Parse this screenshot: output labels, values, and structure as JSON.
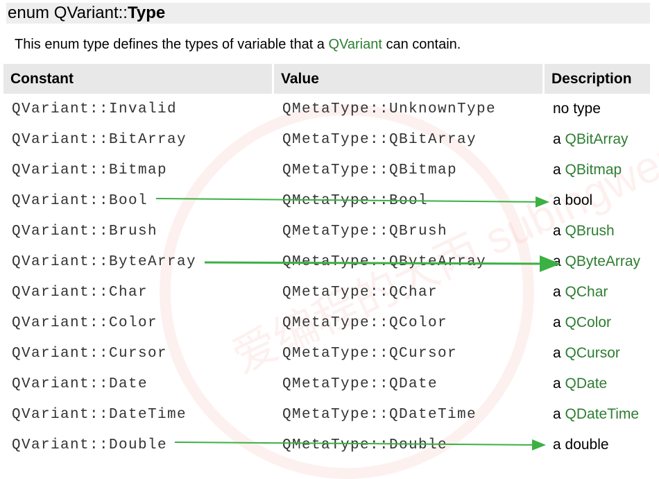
{
  "heading": {
    "prefix": "enum QVariant::",
    "name": "Type"
  },
  "intro": {
    "before": "This enum type defines the types of variable that a ",
    "link": "QVariant",
    "after": " can contain."
  },
  "table": {
    "headers": [
      "Constant",
      "Value",
      "Description"
    ],
    "rows": [
      {
        "constant": "QVariant::Invalid",
        "value": "QMetaType::UnknownType",
        "desc_prefix": "",
        "desc_text": "no type",
        "desc_link": ""
      },
      {
        "constant": "QVariant::BitArray",
        "value": "QMetaType::QBitArray",
        "desc_prefix": "a ",
        "desc_text": "",
        "desc_link": "QBitArray"
      },
      {
        "constant": "QVariant::Bitmap",
        "value": "QMetaType::QBitmap",
        "desc_prefix": "a ",
        "desc_text": "",
        "desc_link": "QBitmap"
      },
      {
        "constant": "QVariant::Bool",
        "value": "QMetaType::Bool",
        "desc_prefix": "a ",
        "desc_text": "bool",
        "desc_link": ""
      },
      {
        "constant": "QVariant::Brush",
        "value": "QMetaType::QBrush",
        "desc_prefix": "a ",
        "desc_text": "",
        "desc_link": "QBrush"
      },
      {
        "constant": "QVariant::ByteArray",
        "value": "QMetaType::QByteArray",
        "desc_prefix": "a ",
        "desc_text": "",
        "desc_link": "QByteArray"
      },
      {
        "constant": "QVariant::Char",
        "value": "QMetaType::QChar",
        "desc_prefix": "a ",
        "desc_text": "",
        "desc_link": "QChar"
      },
      {
        "constant": "QVariant::Color",
        "value": "QMetaType::QColor",
        "desc_prefix": "a ",
        "desc_text": "",
        "desc_link": "QColor"
      },
      {
        "constant": "QVariant::Cursor",
        "value": "QMetaType::QCursor",
        "desc_prefix": "a ",
        "desc_text": "",
        "desc_link": "QCursor"
      },
      {
        "constant": "QVariant::Date",
        "value": "QMetaType::QDate",
        "desc_prefix": "a ",
        "desc_text": "",
        "desc_link": "QDate"
      },
      {
        "constant": "QVariant::DateTime",
        "value": "QMetaType::QDateTime",
        "desc_prefix": "a ",
        "desc_text": "",
        "desc_link": "QDateTime"
      },
      {
        "constant": "QVariant::Double",
        "value": "QMetaType::Double",
        "desc_prefix": "a ",
        "desc_text": "double",
        "desc_link": ""
      }
    ]
  },
  "colors": {
    "link": "#2e7d32",
    "arrow": "#3cb043",
    "header_bg": "#e8e8e8",
    "title_bg": "#eeeeee"
  },
  "annotations": {
    "arrow_rows": [
      3,
      5,
      11
    ]
  },
  "watermark": "爱编程的大丙 subingwen.cn"
}
